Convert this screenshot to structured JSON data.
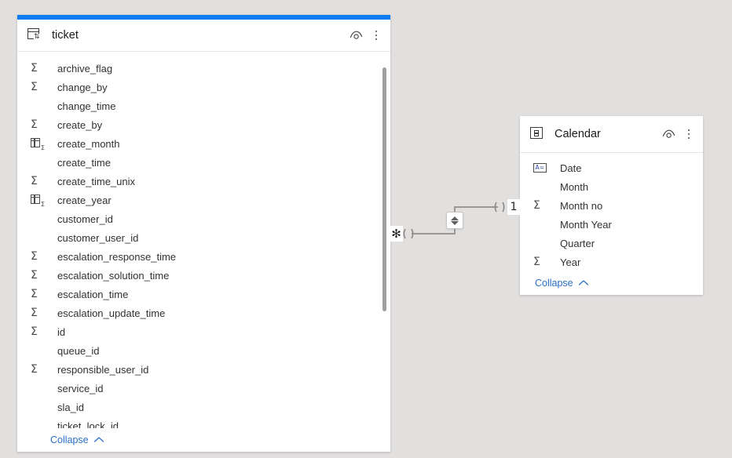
{
  "canvas": {
    "background_color": "#e1e0df",
    "accent_color": "#0c7cf0",
    "link_color": "#2a6fc9"
  },
  "tables": [
    {
      "id": "ticket",
      "name": "ticket",
      "icon": "table-sort-icon",
      "selected": true,
      "hide_label": "Hide",
      "more_label": "More options",
      "collapse_label": "Collapse",
      "fields": [
        {
          "label": "archive_flag",
          "icon": "sigma-icon"
        },
        {
          "label": "change_by",
          "icon": "sigma-icon"
        },
        {
          "label": "change_time",
          "icon": "none"
        },
        {
          "label": "create_by",
          "icon": "sigma-icon"
        },
        {
          "label": "create_month",
          "icon": "group-column-icon"
        },
        {
          "label": "create_time",
          "icon": "none"
        },
        {
          "label": "create_time_unix",
          "icon": "sigma-icon"
        },
        {
          "label": "create_year",
          "icon": "group-column-icon"
        },
        {
          "label": "customer_id",
          "icon": "none"
        },
        {
          "label": "customer_user_id",
          "icon": "none"
        },
        {
          "label": "escalation_response_time",
          "icon": "sigma-icon"
        },
        {
          "label": "escalation_solution_time",
          "icon": "sigma-icon"
        },
        {
          "label": "escalation_time",
          "icon": "sigma-icon"
        },
        {
          "label": "escalation_update_time",
          "icon": "sigma-icon"
        },
        {
          "label": "id",
          "icon": "sigma-icon"
        },
        {
          "label": "queue_id",
          "icon": "none"
        },
        {
          "label": "responsible_user_id",
          "icon": "sigma-icon"
        },
        {
          "label": "service_id",
          "icon": "none"
        },
        {
          "label": "sla_id",
          "icon": "none"
        },
        {
          "label": "ticket_lock_id",
          "icon": "none"
        }
      ]
    },
    {
      "id": "calendar",
      "name": "Calendar",
      "icon": "date-table-icon",
      "selected": false,
      "hide_label": "Hide",
      "more_label": "More options",
      "collapse_label": "Collapse",
      "fields": [
        {
          "label": "Date",
          "icon": "marked-as-date-icon"
        },
        {
          "label": "Month",
          "icon": "none"
        },
        {
          "label": "Month no",
          "icon": "sigma-icon"
        },
        {
          "label": "Month Year",
          "icon": "none"
        },
        {
          "label": "Quarter",
          "icon": "none"
        },
        {
          "label": "Year",
          "icon": "sigma-icon"
        }
      ]
    }
  ],
  "relationship": {
    "from_cardinality": "✻",
    "to_cardinality": "1",
    "cross_filter_direction": "both",
    "cross_filter_label": "Cross filter direction: Both"
  }
}
